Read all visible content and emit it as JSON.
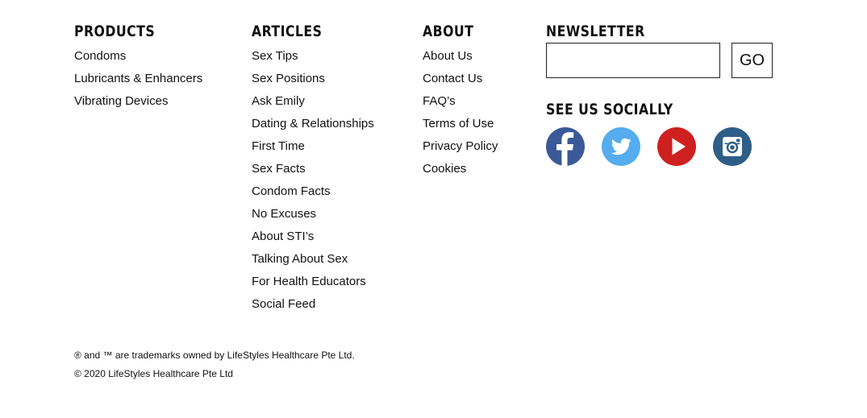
{
  "products": {
    "heading": "PRODUCTS",
    "items": [
      "Condoms",
      "Lubricants & Enhancers",
      "Vibrating Devices"
    ]
  },
  "articles": {
    "heading": "ARTICLES",
    "items": [
      "Sex Tips",
      "Sex Positions",
      "Ask Emily",
      "Dating & Relationships",
      "First Time",
      "Sex Facts",
      "Condom Facts",
      "No Excuses",
      "About STI’s",
      "Talking About Sex",
      "For Health Educators",
      "Social Feed"
    ]
  },
  "about": {
    "heading": "ABOUT",
    "items": [
      "About Us",
      "Contact Us",
      "FAQ’s",
      "Terms of Use",
      "Privacy Policy",
      "Cookies"
    ]
  },
  "newsletter": {
    "heading": "NEWSLETTER",
    "input_value": "",
    "go_label": "GO"
  },
  "social": {
    "heading": "SEE US SOCIALLY",
    "icons": [
      {
        "name": "facebook-icon",
        "color": "#3b5998"
      },
      {
        "name": "twitter-icon",
        "color": "#55acee"
      },
      {
        "name": "youtube-icon",
        "color": "#cd201f"
      },
      {
        "name": "instagram-icon",
        "color": "#2e5e87"
      }
    ]
  },
  "footer": {
    "trademark": "® and ™ are trademarks owned by LifeStyles Healthcare Pte Ltd.",
    "copyright": "© 2020 LifeStyles Healthcare Pte Ltd"
  }
}
